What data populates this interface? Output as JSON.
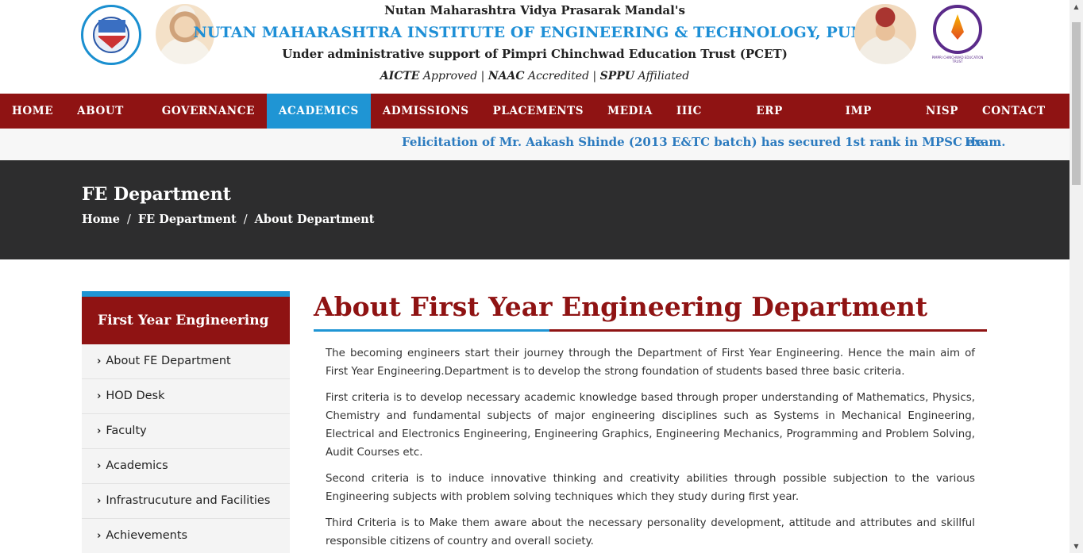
{
  "header": {
    "line1": "Nutan Maharashtra Vidya Prasarak Mandal's",
    "line2": "NUTAN MAHARASHTRA INSTITUTE OF ENGINEERING & TECHNOLOGY, PUNE",
    "line3": "Under administrative support of Pimpri Chinchwad Education Trust (PCET)",
    "accreditation": {
      "aicte": "AICTE",
      "aicte_text": " Approved | ",
      "naac": "NAAC",
      "naac_text": " Accredited | ",
      "sppu": "SPPU",
      "sppu_text": " Affiliated"
    },
    "pcet_caption": "PIMPRI CHINCHWAD EDUCATION TRUST"
  },
  "nav": {
    "items": [
      "HOME",
      "ABOUT US",
      "GOVERNANCE",
      "ACADEMICS",
      "ADMISSIONS",
      "PLACEMENTS",
      "MEDIA",
      "IIIC CELL",
      "ERP LOGIN",
      "IMP LINK",
      "NISP",
      "CONTACT US"
    ],
    "active": "ACADEMICS",
    "colors": {
      "bar": "#8f1313",
      "active": "#1f95d4"
    }
  },
  "ticker": {
    "text": "Felicitation of Mr. Aakash Shinde (2013 E&TC batch) has secured 1st rank in MPSC exam.",
    "next": "He"
  },
  "banner": {
    "title": "FE Department",
    "breadcrumb": [
      "Home",
      "FE Department",
      "About Department"
    ]
  },
  "sidebar": {
    "heading": "First Year Engineering",
    "items": [
      "About FE Department",
      "HOD Desk",
      "Faculty",
      "Academics",
      "Infrastrucuture and Facilities",
      "Achievements"
    ]
  },
  "main": {
    "title": "About First Year Engineering Department",
    "paragraphs": [
      "The becoming engineers start their journey through the Department of First Year Engineering. Hence the main aim of First Year Engineering.Department is to develop the strong foundation of students based three basic criteria.",
      "First criteria is to develop necessary academic knowledge based through proper understanding of Mathematics, Physics, Chemistry and fundamental subjects of major engineering disciplines such as Systems in Mechanical Engineering, Electrical and Electronics Engineering, Engineering Graphics, Engineering Mechanics, Programming and Problem Solving, Audit Courses etc.",
      "Second criteria is to induce innovative thinking and creativity abilities through possible subjection to the various Engineering subjects with problem solving techniques which they study during first year.",
      "Third Criteria is to Make them aware about the necessary personality development, attitude and attributes and skillful responsible citizens of country and overall society."
    ]
  },
  "icons": {
    "sidebar_chevron": "chevron-right-icon",
    "scroll_up": "scroll-up-arrow-icon",
    "scroll_down": "scroll-down-arrow-icon"
  }
}
